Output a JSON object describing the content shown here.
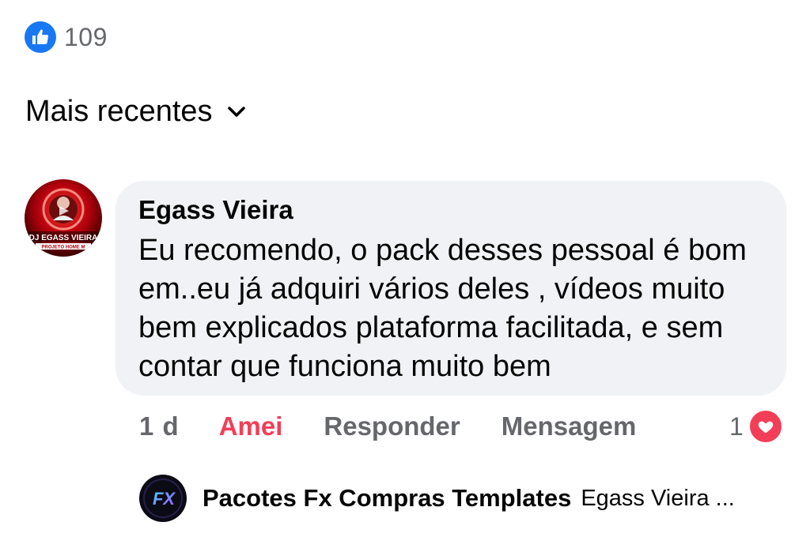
{
  "post_reactions": {
    "icon": "like-icon",
    "count": "109",
    "color": "#1877f2"
  },
  "sort": {
    "label": "Mais recentes",
    "icon": "chevron-down-icon"
  },
  "comment": {
    "author": "Egass Vieira",
    "avatar_text": "DJ EGASS VIEIRA",
    "avatar_subtext": "PROJETO HOME M",
    "text": "Eu recomendo, o pack desses pessoal é bom em..eu já adquiri vários deles , vídeos muito bem explicados plataforma facilitada, e sem contar que funciona muito bem",
    "time": "1 d",
    "actions": {
      "love": "Amei",
      "reply": "Responder",
      "message": "Mensagem"
    },
    "reaction_count": "1",
    "reaction_icon": "love-icon",
    "love_color": "#f33e58"
  },
  "reply_preview": {
    "author": "Pacotes Fx Compras Templates",
    "snippet": "Egass Vieira ...",
    "avatar_text": "FX"
  }
}
